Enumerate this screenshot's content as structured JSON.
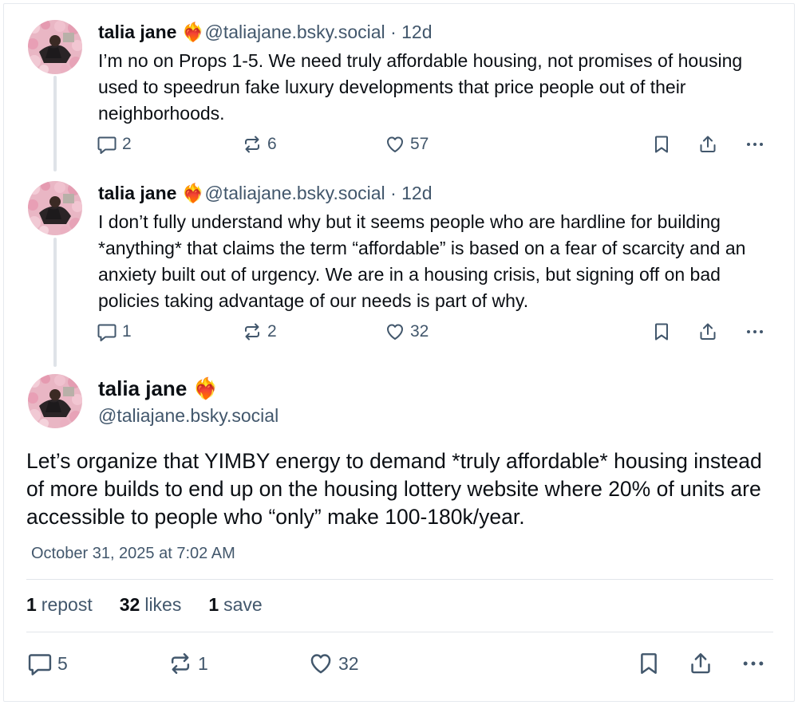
{
  "colors": {
    "text": "#0b0f14",
    "muted": "#42576c",
    "line": "#dfe3e8"
  },
  "posts": [
    {
      "name": "talia jane",
      "emoji": "❤️‍🔥",
      "handle": "@taliajane.bsky.social",
      "age": "· 12d",
      "text": " I’m no on Props 1-5. We need truly affordable housing, not promises of housing used to speedrun fake luxury developments that price people out of their neighborhoods.",
      "replies": "2",
      "reposts": "6",
      "likes": "57"
    },
    {
      "name": "talia jane",
      "emoji": "❤️‍🔥",
      "handle": "@taliajane.bsky.social",
      "age": "· 12d",
      "text": " I don’t fully understand why but it seems people who are hardline for building *anything* that claims the term “affordable” is based on a fear of scarcity and an anxiety built out of urgency. We are in a housing crisis, but signing off on bad policies taking advantage of our needs is part of why.",
      "replies": "1",
      "reposts": "2",
      "likes": "32"
    }
  ],
  "main": {
    "name": "talia jane",
    "emoji": "❤️‍🔥",
    "handle": "@taliajane.bsky.social",
    "text": " Let’s organize that YIMBY energy to demand *truly affordable* housing instead of more builds to end up on the housing lottery website where 20% of units are accessible to people who “only” make 100-180k/year.",
    "timestamp": "October 31, 2025 at 7:02 AM",
    "stats": {
      "reposts_count": "1",
      "reposts_label": "repost",
      "likes_count": "32",
      "likes_label": "likes",
      "saves_count": "1",
      "saves_label": "save"
    },
    "replies": "5",
    "reposts": "1",
    "likes": "32"
  },
  "icons": [
    "reply-icon",
    "repost-icon",
    "like-icon",
    "bookmark-icon",
    "share-icon",
    "more-icon"
  ]
}
